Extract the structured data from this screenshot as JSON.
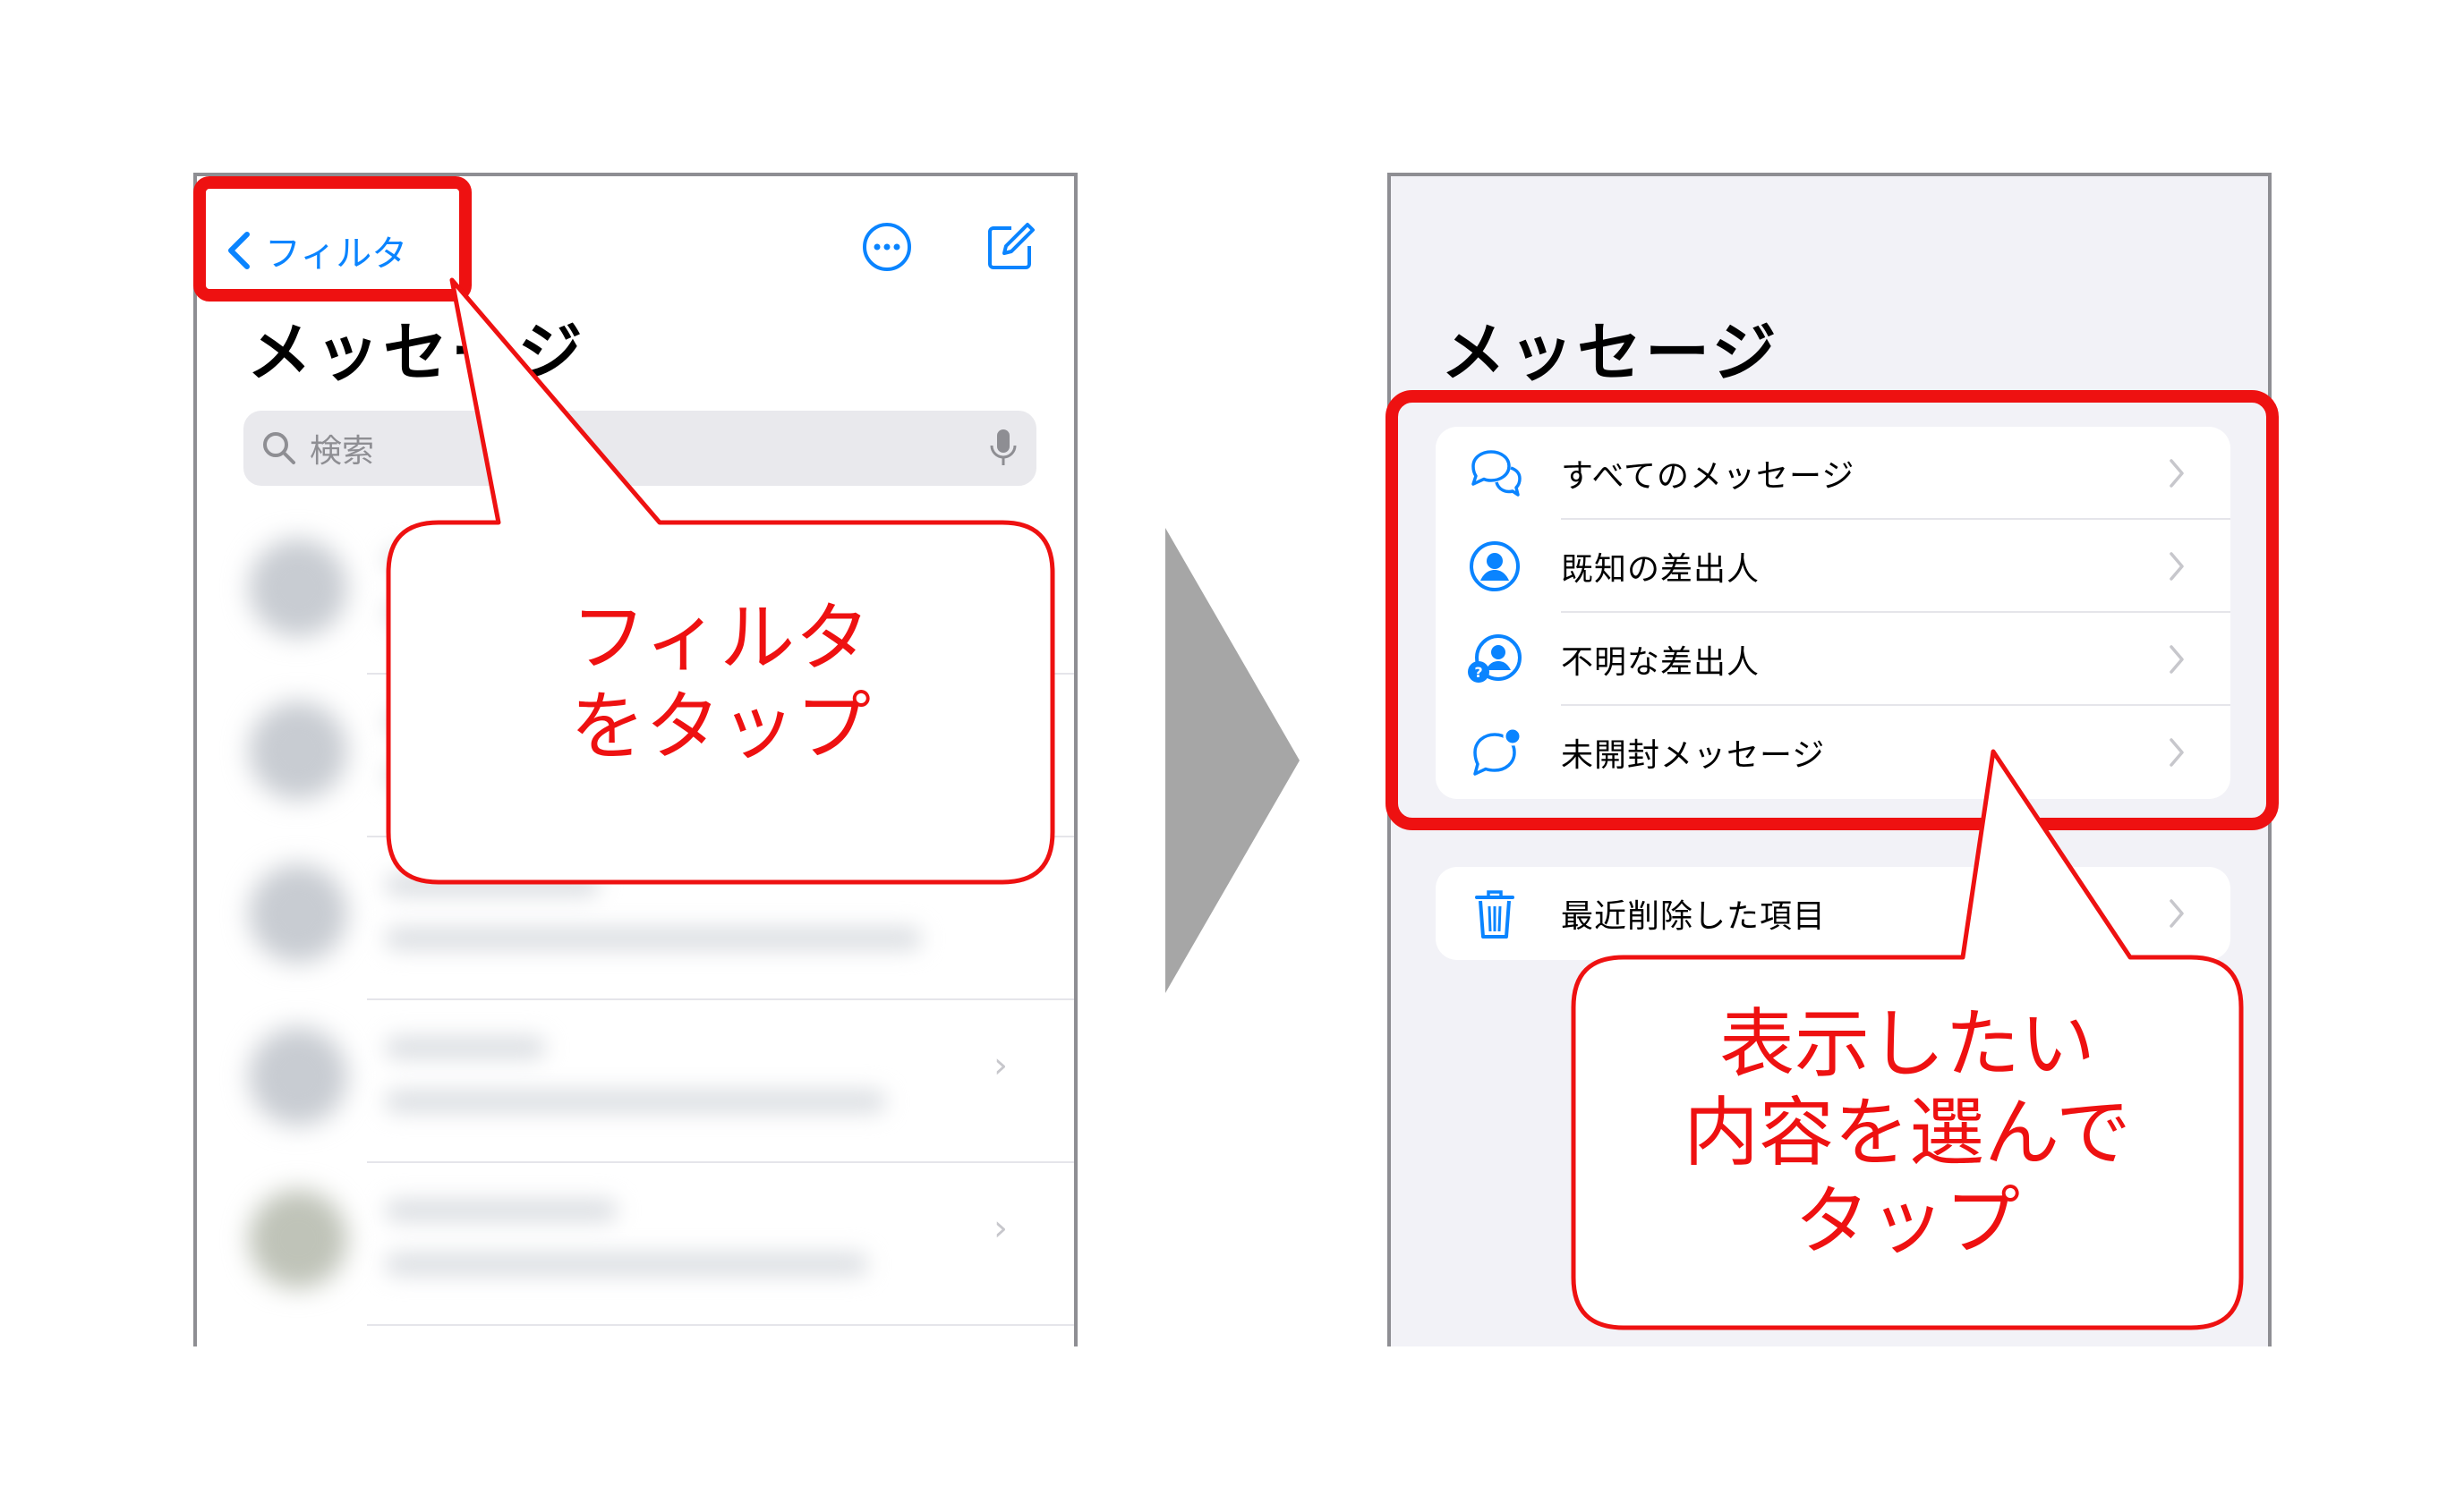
{
  "left_screen": {
    "back_label": "フィルタ",
    "title": "メッセージ",
    "search_placeholder": "検索",
    "icons": {
      "back": "chevron-left-icon",
      "more": "ellipsis-circle-icon",
      "compose": "compose-icon",
      "search": "search-icon",
      "mic": "mic-icon"
    }
  },
  "right_screen": {
    "title": "メッセージ",
    "filters": [
      {
        "label": "すべてのメッセージ",
        "icon": "chat-bubbles-icon"
      },
      {
        "label": "既知の差出人",
        "icon": "person-circle-icon"
      },
      {
        "label": "不明な差出人",
        "icon": "unknown-person-icon"
      },
      {
        "label": "未開封メッセージ",
        "icon": "unread-bubble-icon"
      }
    ],
    "recently_deleted": {
      "label": "最近削除した項目",
      "icon": "trash-icon"
    }
  },
  "callouts": {
    "left": {
      "line1": "フィルタ",
      "line2": "をタップ"
    },
    "right": {
      "line1": "表示したい",
      "line2": "内容を選んで",
      "line3": "タップ"
    }
  },
  "colors": {
    "accent": "#0a84ff",
    "highlight": "#ee1111",
    "arrow": "#a6a6a6"
  }
}
